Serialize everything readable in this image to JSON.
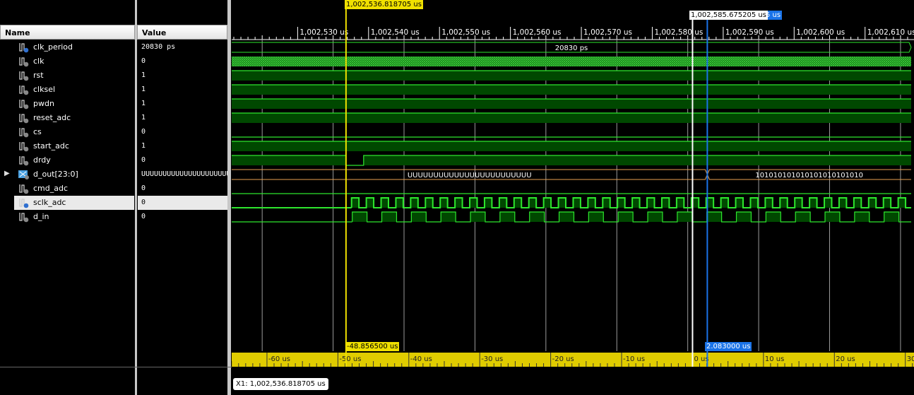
{
  "columns": {
    "name": "Name",
    "value": "Value"
  },
  "signals": [
    {
      "name": "clk_period",
      "value": "20830 ps",
      "icon": "constant-icon",
      "wave": {
        "type": "bus",
        "segments": [
          {
            "t": 0,
            "label": "20830 ps"
          }
        ]
      }
    },
    {
      "name": "clk",
      "value": "0",
      "icon": "signal-icon",
      "wave": {
        "type": "fastclock"
      }
    },
    {
      "name": "rst",
      "value": "1",
      "icon": "signal-icon",
      "wave": {
        "type": "bit",
        "init": 1,
        "edges": []
      }
    },
    {
      "name": "clksel",
      "value": "1",
      "icon": "signal-icon",
      "wave": {
        "type": "bit",
        "init": 1,
        "edges": []
      }
    },
    {
      "name": "pwdn",
      "value": "1",
      "icon": "signal-icon",
      "wave": {
        "type": "bit",
        "init": 1,
        "edges": []
      }
    },
    {
      "name": "reset_adc",
      "value": "1",
      "icon": "signal-icon",
      "wave": {
        "type": "bit",
        "init": 1,
        "edges": []
      }
    },
    {
      "name": "cs",
      "value": "0",
      "icon": "signal-icon",
      "wave": {
        "type": "bit",
        "init": 0,
        "edges": []
      }
    },
    {
      "name": "start_adc",
      "value": "1",
      "icon": "signal-icon",
      "wave": {
        "type": "bit",
        "init": 1,
        "edges": []
      }
    },
    {
      "name": "drdy",
      "value": "0",
      "icon": "signal-icon",
      "wave": {
        "type": "bit",
        "init": 1,
        "edges": [
          [
            1002536.82,
            0
          ],
          [
            1002539.3,
            1
          ]
        ]
      }
    },
    {
      "name": "d_out[23:0]",
      "value": "UUUUUUUUUUUUUUUUUUUUUUUU",
      "icon": "bus-icon",
      "expandable": true,
      "wave": {
        "type": "bus",
        "color": "#e8a050",
        "segments": [
          {
            "t": 0,
            "label": "UUUUUUUUUUUUUUUUUUUUUUUU"
          },
          {
            "t": 1002587.76,
            "label": "101010101010101010101010"
          }
        ]
      }
    },
    {
      "name": "cmd_adc",
      "value": "0",
      "icon": "signal-icon",
      "wave": {
        "type": "bit",
        "init": 0,
        "edges": []
      }
    },
    {
      "name": "sclk_adc",
      "value": "0",
      "icon": "signal-icon",
      "selected": true,
      "wave": {
        "type": "clock",
        "start": 1002537.6,
        "period": 2.083
      }
    },
    {
      "name": "d_in",
      "value": "0",
      "icon": "signal-icon",
      "wave": {
        "type": "clock",
        "start": 1002537.7,
        "period": 4.166
      }
    }
  ],
  "timeline": {
    "view_start_us": 1002520.7,
    "view_end_us": 1002616.9,
    "major_labels": [
      {
        "t": 1002530,
        "label": "1,002,530 us"
      },
      {
        "t": 1002540,
        "label": "1,002,540 us"
      },
      {
        "t": 1002550,
        "label": "1,002,550 us"
      },
      {
        "t": 1002560,
        "label": "1,002,560 us"
      },
      {
        "t": 1002570,
        "label": "1,002,570 us"
      },
      {
        "t": 1002580,
        "label": "1,002,580 us"
      },
      {
        "t": 1002590,
        "label": "1,002,590 us"
      },
      {
        "t": 1002600,
        "label": "1,002,600 us"
      },
      {
        "t": 1002610,
        "label": "1,002,610 us"
      }
    ]
  },
  "cursors": {
    "yellow": {
      "t": 1002536.818705,
      "label": "1,002,536.818705 us",
      "color": "#f0e000"
    },
    "white": {
      "t": 1002585.675205,
      "label": "1,002,585.675205 us"
    },
    "blue": {
      "t": 1002587.758205,
      "label": "5 us",
      "color": "#1a73e8"
    }
  },
  "relative_ruler": {
    "origin_us": 1002585.675205,
    "labels": [
      "-60 us",
      "-50 us",
      "-40 us",
      "-30 us",
      "-20 us",
      "-10 us",
      "0 us",
      "10 us",
      "20 us",
      "30"
    ],
    "yellow_delta": "-48.856500 us",
    "blue_delta": "2.083000 us"
  },
  "status": {
    "x1": "X1: 1,002,536.818705 us"
  },
  "colors": {
    "wave": "#2ee62e",
    "fill": "#004800",
    "grid": "#c8c8c8"
  }
}
